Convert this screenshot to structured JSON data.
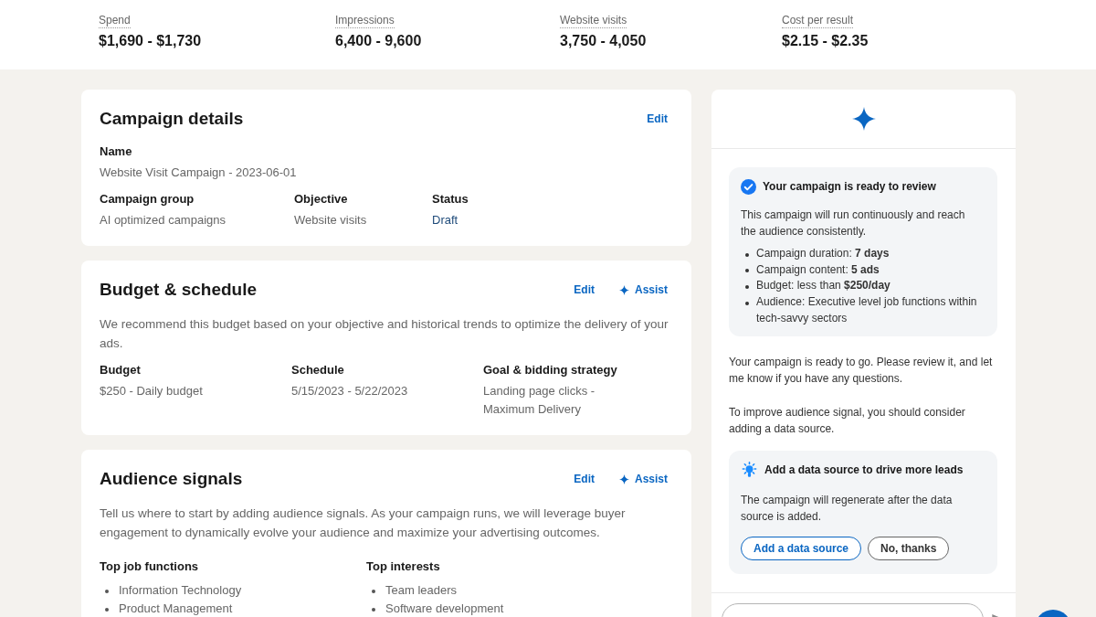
{
  "forecast": {
    "metrics": [
      {
        "label": "Spend",
        "value": "$1,690 - $1,730"
      },
      {
        "label": "Impressions",
        "value": "6,400 - 9,600"
      },
      {
        "label": "Website visits",
        "value": "3,750 - 4,050"
      },
      {
        "label": "Cost per result",
        "value": "$2.15 - $2.35"
      }
    ]
  },
  "cards": [
    {
      "title": "Campaign details",
      "actions": [
        {
          "kind": "edit",
          "label": "Edit"
        }
      ],
      "field_rows": [
        [
          {
            "label": "Name",
            "value": "Website Visit Campaign - 2023-06-01",
            "kind": "text"
          }
        ],
        [
          {
            "label": "Campaign group",
            "value": "AI optimized campaigns",
            "kind": "text"
          },
          {
            "label": "Objective",
            "value": "Website visits",
            "kind": "text"
          },
          {
            "label": "Status",
            "value": "Draft",
            "kind": "status"
          }
        ]
      ]
    },
    {
      "title": "Budget & schedule",
      "actions": [
        {
          "kind": "edit",
          "label": "Edit"
        },
        {
          "kind": "assist",
          "label": "Assist"
        }
      ],
      "description": "We recommend this budget based on your objective and historical trends to optimize the delivery of your ads.",
      "field_rows": [
        [
          {
            "label": "Budget",
            "value": "$250 - Daily budget",
            "kind": "text"
          },
          {
            "label": "Schedule",
            "value": "5/15/2023 - 5/22/2023",
            "kind": "text"
          },
          {
            "label": "Goal & bidding strategy",
            "value": "Landing page clicks - Maximum Delivery",
            "kind": "text"
          }
        ]
      ]
    },
    {
      "title": "Audience signals",
      "actions": [
        {
          "kind": "edit",
          "label": "Edit"
        },
        {
          "kind": "assist",
          "label": "Assist"
        }
      ],
      "description": "Tell us where to start by adding audience signals. As your campaign runs, we will leverage buyer engagement to dynamically evolve your audience and maximize your advertising outcomes.",
      "lists": [
        {
          "label": "Top job functions",
          "items": [
            "Information Technology",
            "Product Management"
          ]
        },
        {
          "label": "Top interests",
          "items": [
            "Team leaders",
            "Software development"
          ]
        }
      ]
    }
  ],
  "assistant": {
    "summary": {
      "title": "Your campaign is ready to review",
      "body": "This campaign will run continuously and reach the audience consistently.",
      "bullets": [
        "Campaign duration: **7 days**",
        "Campaign content: **5 ads**",
        "Budget: less than **$250/day**",
        "Audience: Executive level job functions within tech-savvy sectors"
      ]
    },
    "messages": [
      "Your campaign is ready to go. Please review it, and let me know if you have any questions.",
      "To improve audience signal, you should consider adding a data source."
    ],
    "suggestion": {
      "title": "Add a data source to drive more leads",
      "body": "The campaign will regenerate after the data source is added.",
      "buttons": [
        {
          "kind": "primary",
          "label": "Add a data source"
        },
        {
          "kind": "secondary",
          "label": "No, thanks"
        }
      ]
    }
  }
}
